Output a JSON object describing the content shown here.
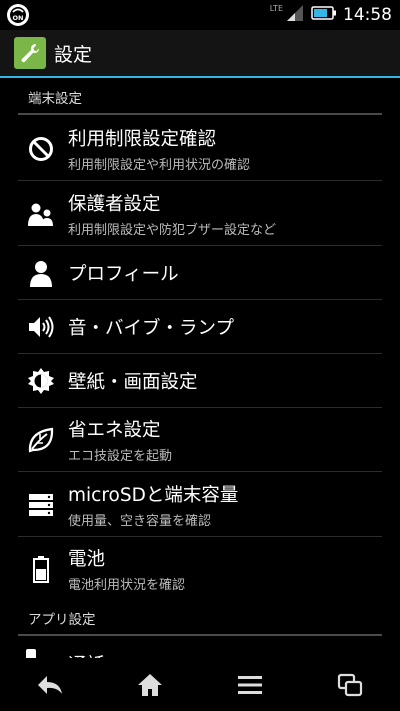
{
  "statusbar": {
    "network_label": "LTE",
    "time": "14:58",
    "left_badge": "ON"
  },
  "actionbar": {
    "title": "設定"
  },
  "sections": [
    {
      "header": "端末設定"
    },
    {
      "header": "アプリ設定"
    }
  ],
  "items": [
    {
      "title": "利用制限設定確認",
      "subtitle": "利用制限設定や利用状況の確認",
      "icon": "prohibited-icon"
    },
    {
      "title": "保護者設定",
      "subtitle": "利用制限設定や防犯ブザー設定など",
      "icon": "parent-child-icon"
    },
    {
      "title": "プロフィール",
      "subtitle": "",
      "icon": "person-icon"
    },
    {
      "title": "音・バイブ・ランプ",
      "subtitle": "",
      "icon": "speaker-icon"
    },
    {
      "title": "壁紙・画面設定",
      "subtitle": "",
      "icon": "brightness-icon"
    },
    {
      "title": "省エネ設定",
      "subtitle": "エコ技設定を起動",
      "icon": "leaf-icon"
    },
    {
      "title": "microSDと端末容量",
      "subtitle": "使用量、空き容量を確認",
      "icon": "storage-icon"
    },
    {
      "title": "電池",
      "subtitle": "電池利用状況を確認",
      "icon": "battery-icon"
    }
  ],
  "partial_item": {
    "title": "通話"
  },
  "colors": {
    "accent": "#33b5e5",
    "app_icon_bg": "#7ab648",
    "background": "#000000"
  }
}
